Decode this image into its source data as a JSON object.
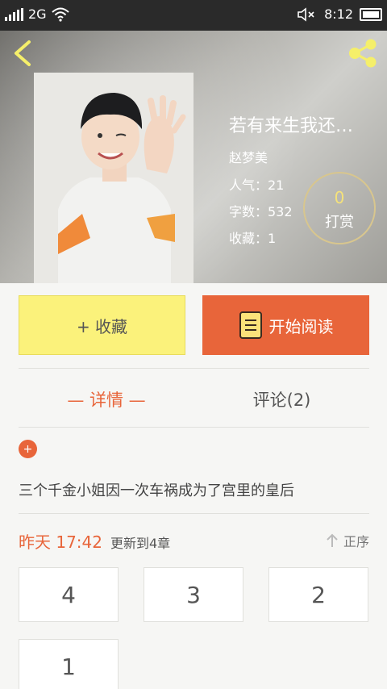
{
  "status_bar": {
    "network": "2G",
    "time": "8:12",
    "sim": "2"
  },
  "header": {
    "title": "若有来生我还…",
    "author": "赵梦美",
    "popularity": "人气：21",
    "word_count": "字数：532",
    "favorites": "收藏：1",
    "tip": {
      "count": "0",
      "label": "打赏"
    }
  },
  "actions": {
    "favorite_label": "+ 收藏",
    "read_label": "开始阅读"
  },
  "tabs": {
    "details": "— 详情 —",
    "comments": "评论(2)"
  },
  "synopsis": {
    "badge": "+",
    "text": "三个千金小姐因一次车祸成为了宫里的皇后"
  },
  "update": {
    "time": "昨天 17:42",
    "info": "更新到4章",
    "sort_label": "正序"
  },
  "chapters": [
    "4",
    "3",
    "2",
    "1"
  ],
  "colors": {
    "accent": "#e8653a",
    "favorite_bg": "#fbf27b",
    "status_bar": "#2a2a2a"
  }
}
